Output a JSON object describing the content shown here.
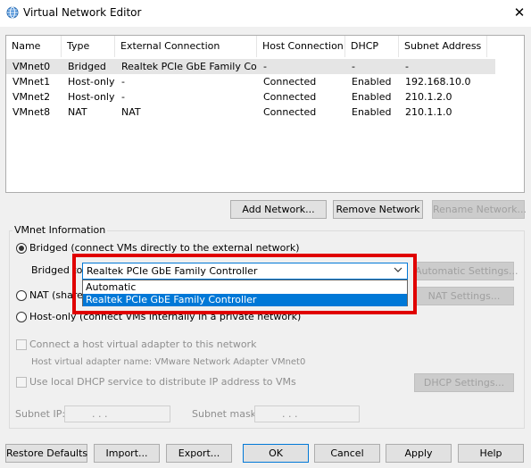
{
  "window": {
    "title": "Virtual Network Editor",
    "close_glyph": "✕"
  },
  "networks": {
    "columns": [
      "Name",
      "Type",
      "External Connection",
      "Host Connection",
      "DHCP",
      "Subnet Address"
    ],
    "rows": [
      [
        "VMnet0",
        "Bridged",
        "Realtek PCIe GbE Family Co...",
        "-",
        "-",
        "-"
      ],
      [
        "VMnet1",
        "Host-only",
        "-",
        "Connected",
        "Enabled",
        "192.168.10.0"
      ],
      [
        "VMnet2",
        "Host-only",
        "-",
        "Connected",
        "Enabled",
        "210.1.2.0"
      ],
      [
        "VMnet8",
        "NAT",
        "NAT",
        "Connected",
        "Enabled",
        "210.1.1.0"
      ]
    ],
    "selected_row": 0
  },
  "network_buttons": {
    "add": "Add Network...",
    "remove": "Remove Network",
    "rename": "Rename Network..."
  },
  "vmnet_info": {
    "group_label": "VMnet Information",
    "bridged_label": "Bridged (connect VMs directly to the external network)",
    "bridged_to_label": "Bridged to:",
    "bridged_to_value": "Realtek PCIe GbE Family Controller",
    "bridged_to_options": [
      "Automatic",
      "Realtek PCIe GbE Family Controller"
    ],
    "automatic_settings": "Automatic Settings...",
    "nat_label": "NAT (shared host's IP address with VMs)",
    "nat_settings": "NAT Settings...",
    "hostonly_label": "Host-only (connect VMs internally in a private network)",
    "connect_adapter_label": "Connect a host virtual adapter to this network",
    "adapter_name_label": "Host virtual adapter name: VMware Network Adapter VMnet0",
    "dhcp_label": "Use local DHCP service to distribute IP address to VMs",
    "dhcp_settings": "DHCP Settings...",
    "subnet_ip_label": "Subnet IP:",
    "subnet_mask_label": "Subnet mask:",
    "ip_dots": ".       .       ."
  },
  "footer": {
    "restore": "Restore Defaults",
    "import": "Import...",
    "export": "Export...",
    "ok": "OK",
    "cancel": "Cancel",
    "apply": "Apply",
    "help": "Help"
  },
  "colors": {
    "highlight": "#e00000",
    "selection": "#0078d7"
  }
}
